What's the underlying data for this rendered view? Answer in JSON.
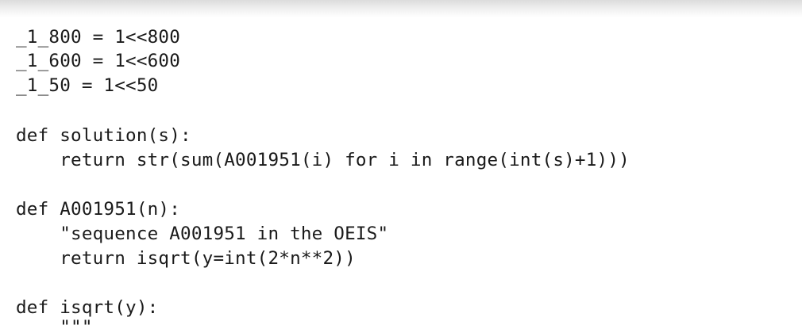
{
  "code": {
    "lines": [
      "_1_800 = 1<<800",
      "_1_600 = 1<<600",
      "_1_50 = 1<<50",
      "",
      "def solution(s):",
      "    return str(sum(A001951(i) for i in range(int(s)+1)))",
      "",
      "def A001951(n):",
      "    \"sequence A001951 in the OEIS\"",
      "    return isqrt(y=int(2*n**2))",
      "",
      "def isqrt(y):",
      "    \"\"\""
    ]
  }
}
